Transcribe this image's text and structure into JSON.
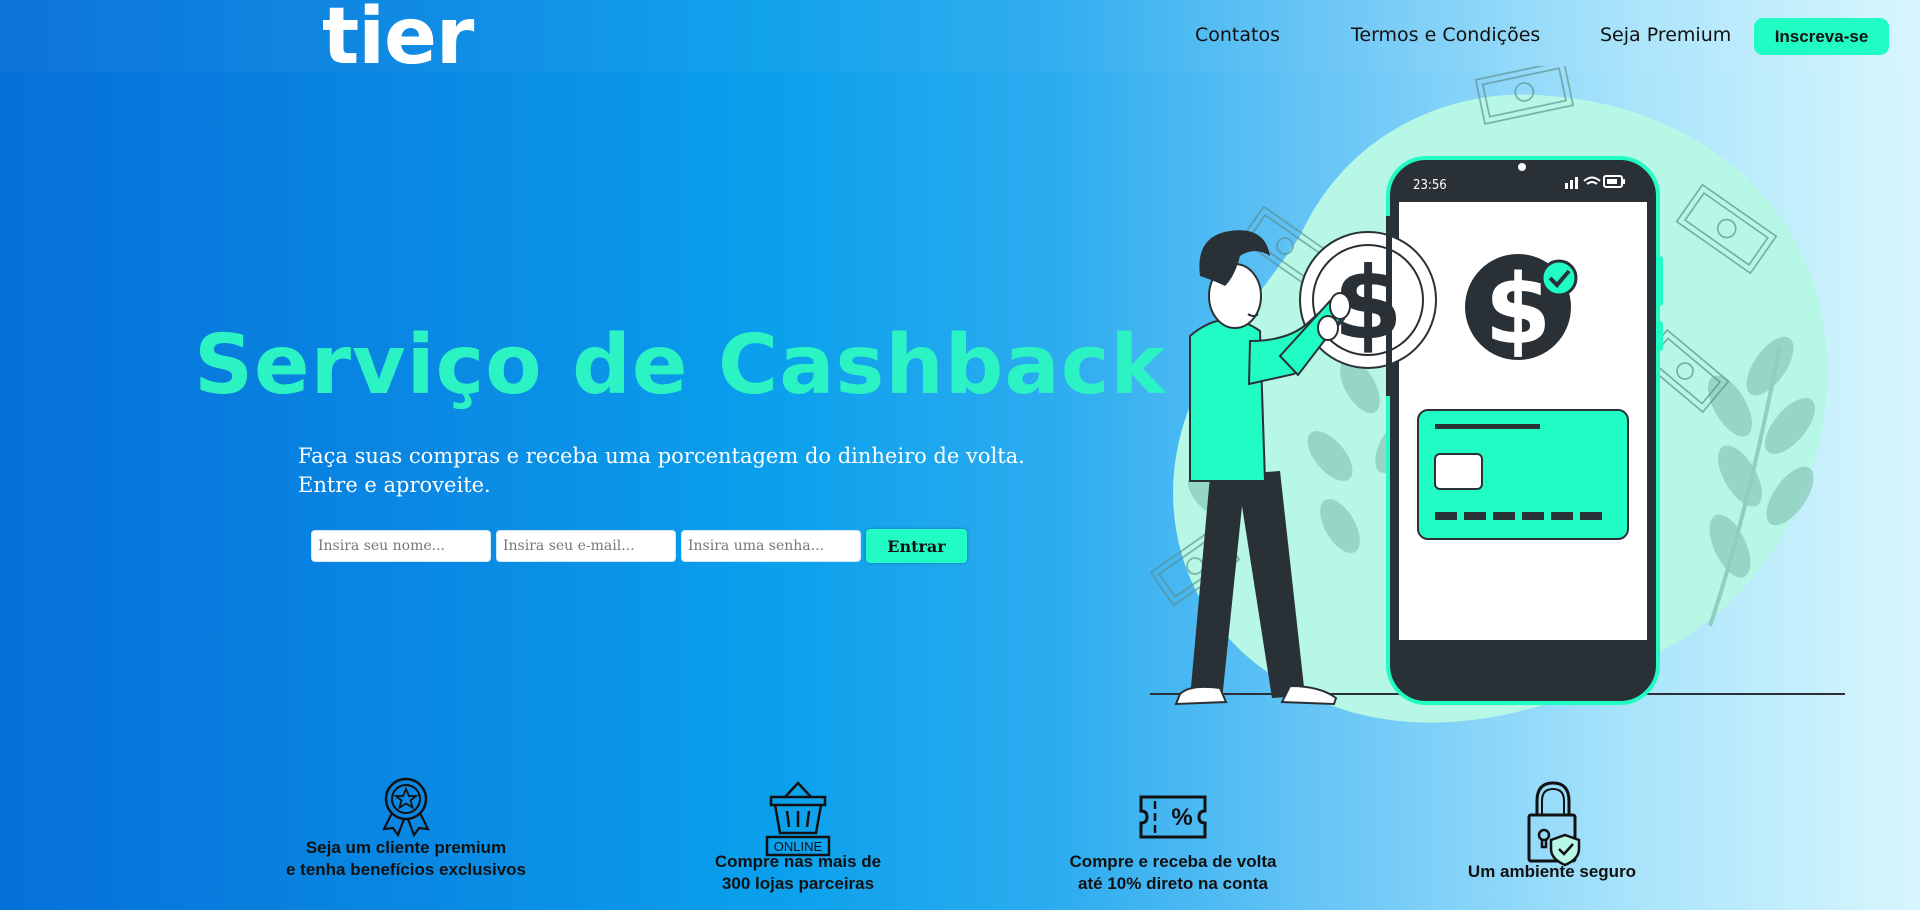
{
  "header": {
    "logo": "tier",
    "nav": [
      "Contatos",
      "Termos e Condições",
      "Seja Premium"
    ],
    "signup_label": "Inscreva-se"
  },
  "hero": {
    "title": "Serviço de Cashback",
    "subtitle_line1": "Faça suas compras e receba uma porcentagem do dinheiro de volta.",
    "subtitle_line2": "Entre e aproveite.",
    "form": {
      "name_placeholder": "Insira seu nome...",
      "email_placeholder": "Insira seu e-mail...",
      "password_placeholder": "Insira uma senha...",
      "submit_label": "Entrar"
    }
  },
  "illustration": {
    "phone_time": "23:56",
    "icons": [
      "dollar-coin-icon",
      "dollar-check-icon",
      "credit-card-icon"
    ]
  },
  "features": [
    {
      "icon": "award-badge-icon",
      "line1": "Seja um cliente premium",
      "line2": "e tenha benefícios exclusivos"
    },
    {
      "icon": "shopping-basket-icon",
      "badge": "ONLINE",
      "line1": "Compre nas mais de",
      "line2": "300 lojas parceiras"
    },
    {
      "icon": "percent-ticket-icon",
      "line1": "Compre e receba de volta",
      "line2": "até 10% direto na conta"
    },
    {
      "icon": "padlock-shield-icon",
      "line1": "Um ambiente seguro",
      "line2": ""
    }
  ],
  "colors": {
    "accent": "#21fbc4",
    "title": "#2cf3c3",
    "dark": "#2a3136"
  }
}
